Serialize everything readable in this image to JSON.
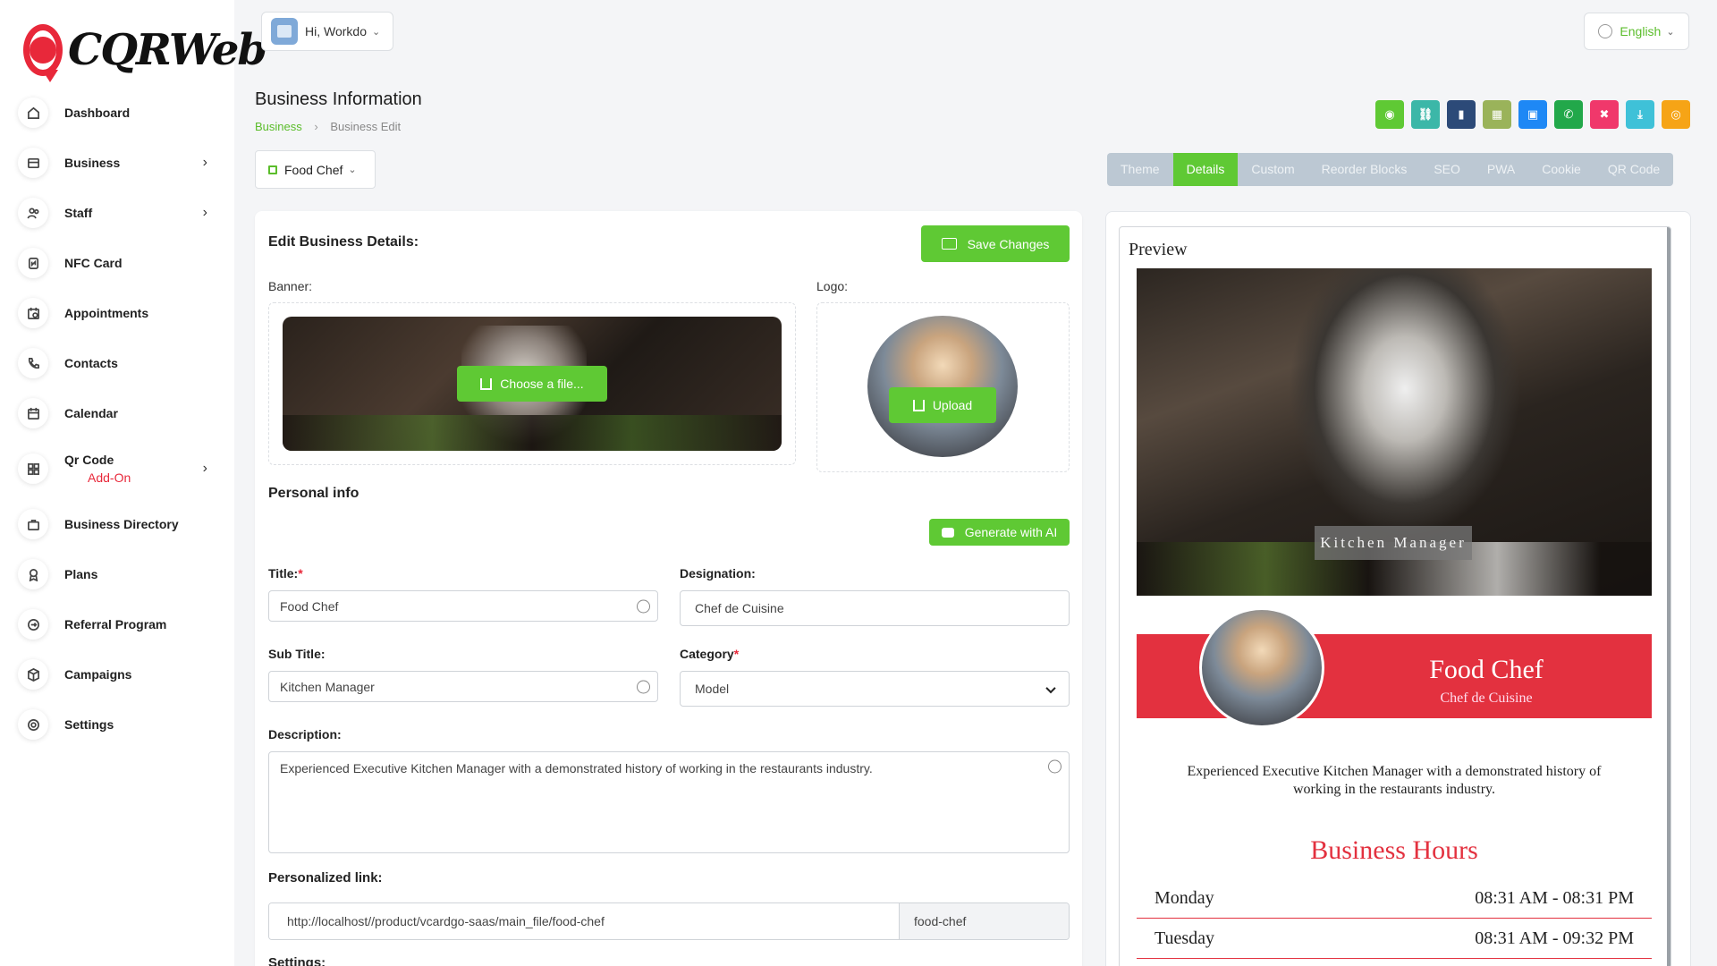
{
  "brand": {
    "logo_text": "CQRWeb",
    "accent": "#5fc934",
    "brand_red": "#e8283a"
  },
  "sidebar": {
    "items": [
      {
        "label": "Dashboard",
        "icon": "home-icon",
        "has_children": false
      },
      {
        "label": "Business",
        "icon": "card-icon",
        "has_children": true
      },
      {
        "label": "Staff",
        "icon": "users-icon",
        "has_children": true
      },
      {
        "label": "NFC Card",
        "icon": "nfc-icon",
        "has_children": false
      },
      {
        "label": "Appointments",
        "icon": "calendar-check-icon",
        "has_children": false
      },
      {
        "label": "Contacts",
        "icon": "phone-icon",
        "has_children": false
      },
      {
        "label": "Calendar",
        "icon": "calendar-icon",
        "has_children": false
      },
      {
        "label": "Qr Code",
        "sub": "Add-On",
        "icon": "qr-icon",
        "has_children": true
      },
      {
        "label": "Business Directory",
        "icon": "briefcase-icon",
        "has_children": false
      },
      {
        "label": "Plans",
        "icon": "award-icon",
        "has_children": false
      },
      {
        "label": "Referral Program",
        "icon": "referral-icon",
        "has_children": false
      },
      {
        "label": "Campaigns",
        "icon": "box-icon",
        "has_children": false
      },
      {
        "label": "Settings",
        "icon": "gear-icon",
        "has_children": false
      }
    ]
  },
  "header": {
    "greeting": "Hi, Workdo",
    "language": "English"
  },
  "page": {
    "title": "Business Information",
    "breadcrumb": [
      "Business",
      "Business Edit"
    ],
    "business_selected": "Food Chef",
    "action_icons": [
      {
        "name": "whatsapp-icon",
        "color": "#5fc934",
        "glyph": "◉"
      },
      {
        "name": "link-icon",
        "color": "#3cb7a8",
        "glyph": "⛓"
      },
      {
        "name": "chart-icon",
        "color": "#2c4a78",
        "glyph": "▮"
      },
      {
        "name": "calendar-icon",
        "color": "#9ab35a",
        "glyph": "▦"
      },
      {
        "name": "qr-icon",
        "color": "#1e88f5",
        "glyph": "▣"
      },
      {
        "name": "phone-icon",
        "color": "#22a84a",
        "glyph": "✆"
      },
      {
        "name": "trash-icon",
        "color": "#f0386b",
        "glyph": "✖"
      },
      {
        "name": "download-icon",
        "color": "#3fc1d8",
        "glyph": "⤓"
      },
      {
        "name": "eye-icon",
        "color": "#f6a416",
        "glyph": "◎"
      }
    ],
    "tabs": [
      "Theme",
      "Details",
      "Custom",
      "Reorder Blocks",
      "SEO",
      "PWA",
      "Cookie",
      "QR Code"
    ],
    "active_tab": "Details"
  },
  "form": {
    "heading": "Edit Business Details:",
    "save_label": "Save Changes",
    "banner_label": "Banner:",
    "banner_button": "Choose a file...",
    "logo_label": "Logo:",
    "logo_button": "Upload",
    "personal_info": "Personal info",
    "ai_button": "Generate with AI",
    "title_label": "Title:",
    "title_required": "*",
    "title_value": "Food Chef",
    "designation_label": "Designation:",
    "designation_value": "Chef de Cuisine",
    "subtitle_label": "Sub Title:",
    "subtitle_value": "Kitchen Manager",
    "category_label": "Category",
    "category_required": "*",
    "category_value": "Model",
    "description_label": "Description:",
    "description_value": "Experienced Executive Kitchen Manager with a demonstrated history of working in the restaurants industry.",
    "link_label": "Personalized link:",
    "link_base": "http://localhost//product/vcardgo-saas/main_file/food-chef",
    "link_slug": "food-chef",
    "settings_label": "Settings:"
  },
  "preview": {
    "title": "Preview",
    "hero_tag": "Kitchen Manager",
    "name": "Food Chef",
    "role": "Chef de Cuisine",
    "description": "Experienced Executive Kitchen Manager with a demonstrated history of working in the restaurants industry.",
    "hours_title": "Business Hours",
    "hours": [
      {
        "day": "Monday",
        "time": "08:31 AM - 08:31 PM"
      },
      {
        "day": "Tuesday",
        "time": "08:31 AM - 09:32 PM"
      }
    ]
  }
}
